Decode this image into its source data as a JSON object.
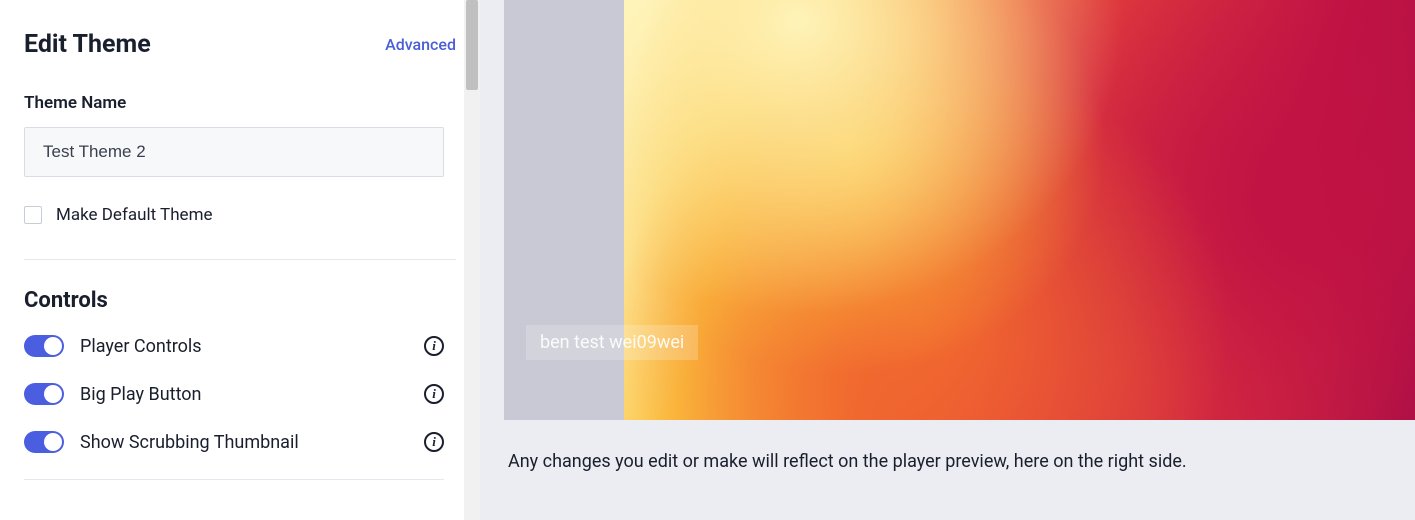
{
  "panel": {
    "title": "Edit Theme",
    "advanced_link": "Advanced",
    "theme_name_label": "Theme Name",
    "theme_name_value": "Test Theme 2",
    "default_checkbox_label": "Make Default Theme",
    "default_checked": false
  },
  "controls": {
    "section_title": "Controls",
    "items": [
      {
        "label": "Player Controls",
        "enabled": true
      },
      {
        "label": "Big Play Button",
        "enabled": true
      },
      {
        "label": "Show Scrubbing Thumbnail",
        "enabled": true
      }
    ]
  },
  "preview": {
    "video_title": "ben test wei09wei",
    "note": "Any changes you edit or make will reflect on the player preview, here on the right side."
  }
}
